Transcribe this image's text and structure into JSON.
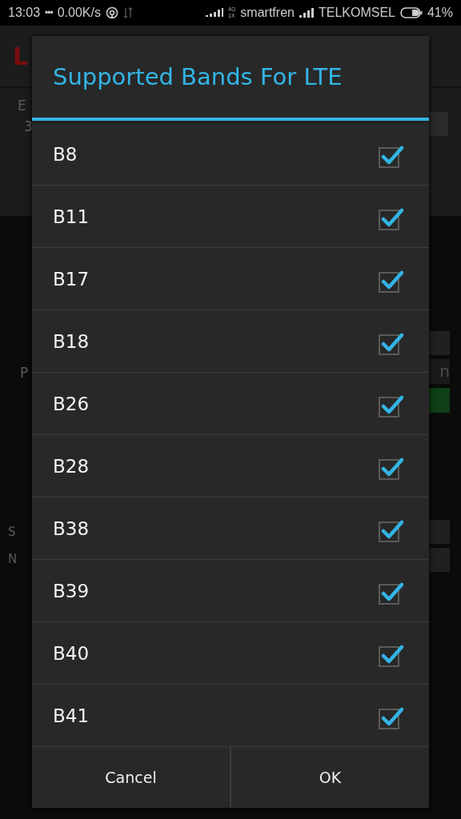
{
  "status_bar": {
    "time": "13:03",
    "dots": "•••",
    "speed": "0.00K/s",
    "network_type_top": "4G",
    "network_type_bottom": "1X",
    "carrier_1": "smartfren",
    "carrier_2": "TELKOMSEL",
    "battery": "41%"
  },
  "background": {
    "title_fragment": "L",
    "label_1": "E",
    "value_1": "3",
    "label_2": "P",
    "button_fragment": "n",
    "label_3": "S",
    "label_4": "N"
  },
  "dialog": {
    "title": "Supported Bands For LTE",
    "bands": [
      {
        "label": "B8",
        "checked": true
      },
      {
        "label": "B11",
        "checked": true
      },
      {
        "label": "B17",
        "checked": true
      },
      {
        "label": "B18",
        "checked": true
      },
      {
        "label": "B26",
        "checked": true
      },
      {
        "label": "B28",
        "checked": true
      },
      {
        "label": "B38",
        "checked": true
      },
      {
        "label": "B39",
        "checked": true
      },
      {
        "label": "B40",
        "checked": true
      },
      {
        "label": "B41",
        "checked": true
      }
    ],
    "buttons": [
      "Cancel",
      "OK"
    ]
  }
}
